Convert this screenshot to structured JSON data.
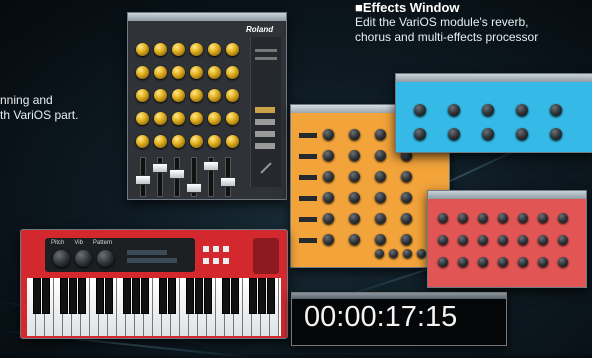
{
  "captions": {
    "effects_heading": "■Effects Window",
    "effects_line1": "Edit the VariOS module's reverb,",
    "effects_line2": "chorus and multi-effects processor",
    "mixer_line1": "nning and",
    "mixer_line2": "th VariOS part."
  },
  "mixer_window": {
    "brand": "Roland",
    "knob_rows": 5,
    "knob_columns": 6,
    "fader_count": 6
  },
  "keyboard_window": {
    "knob_labels": [
      "Pitch",
      "Vib",
      "Pattern"
    ]
  },
  "timecode_window": {
    "value": "00:00:17:15"
  },
  "colors": {
    "effects_orange": "#f2a33a",
    "effects_blue": "#35b9e6",
    "effects_red": "#e25555",
    "keyboard_red": "#d2282e",
    "mixer_panel": "#2f3338",
    "knob_gold": "#e3b020"
  }
}
